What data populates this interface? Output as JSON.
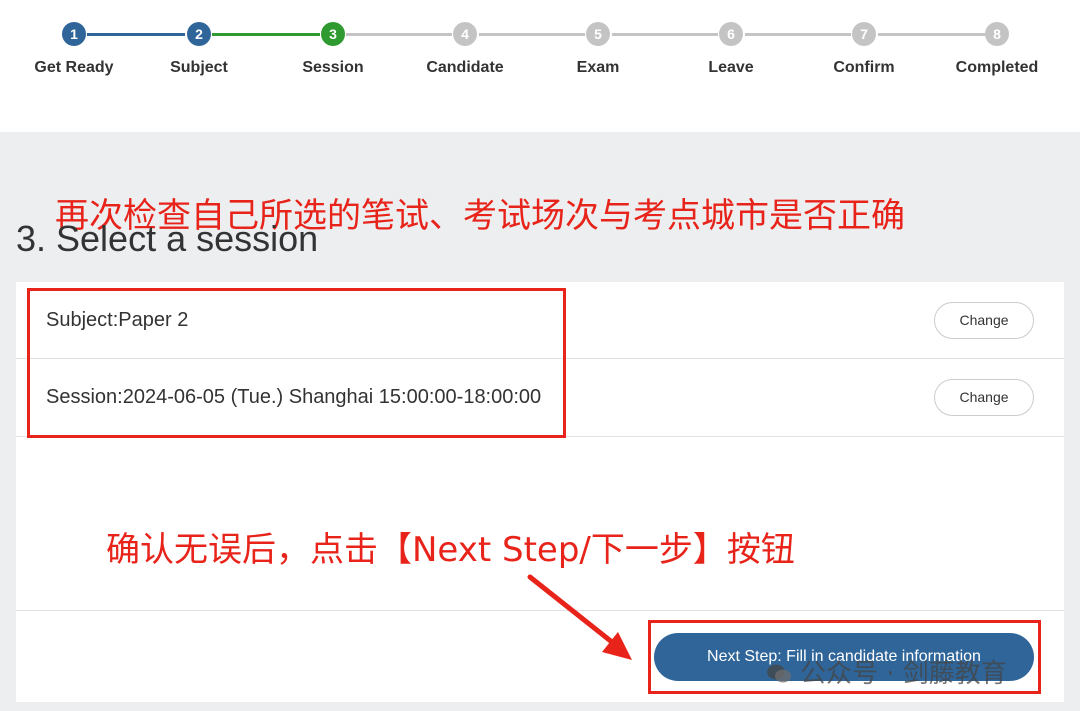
{
  "stepper": {
    "steps": [
      {
        "number": "1",
        "label": "Get Ready",
        "state": "done"
      },
      {
        "number": "2",
        "label": "Subject",
        "state": "done"
      },
      {
        "number": "3",
        "label": "Session",
        "state": "current"
      },
      {
        "number": "4",
        "label": "Candidate",
        "state": "todo"
      },
      {
        "number": "5",
        "label": "Exam",
        "state": "todo"
      },
      {
        "number": "6",
        "label": "Leave",
        "state": "todo"
      },
      {
        "number": "7",
        "label": "Confirm",
        "state": "todo"
      },
      {
        "number": "8",
        "label": "Completed",
        "state": "todo"
      }
    ],
    "colors": {
      "done": "#2f6599",
      "current": "#2e9a2f",
      "todo": "#c4c4c4"
    }
  },
  "page": {
    "title": "3. Select a session"
  },
  "summary": {
    "subject_text": "Subject:Paper 2",
    "subject_change": "Change",
    "session_text": "Session:2024-06-05 (Tue.) Shanghai 15:00:00-18:00:00",
    "session_change": "Change"
  },
  "actions": {
    "next_step": "Next Step: Fill in candidate information"
  },
  "annotations": {
    "top": "再次检查自己所选的笔试、考试场次与考点城市是否正确",
    "middle": "确认无误后，点击【Next Step/下一步】按钮",
    "color": "#e8231a"
  },
  "watermark": {
    "text": "公众号 · 剑藤教育"
  }
}
